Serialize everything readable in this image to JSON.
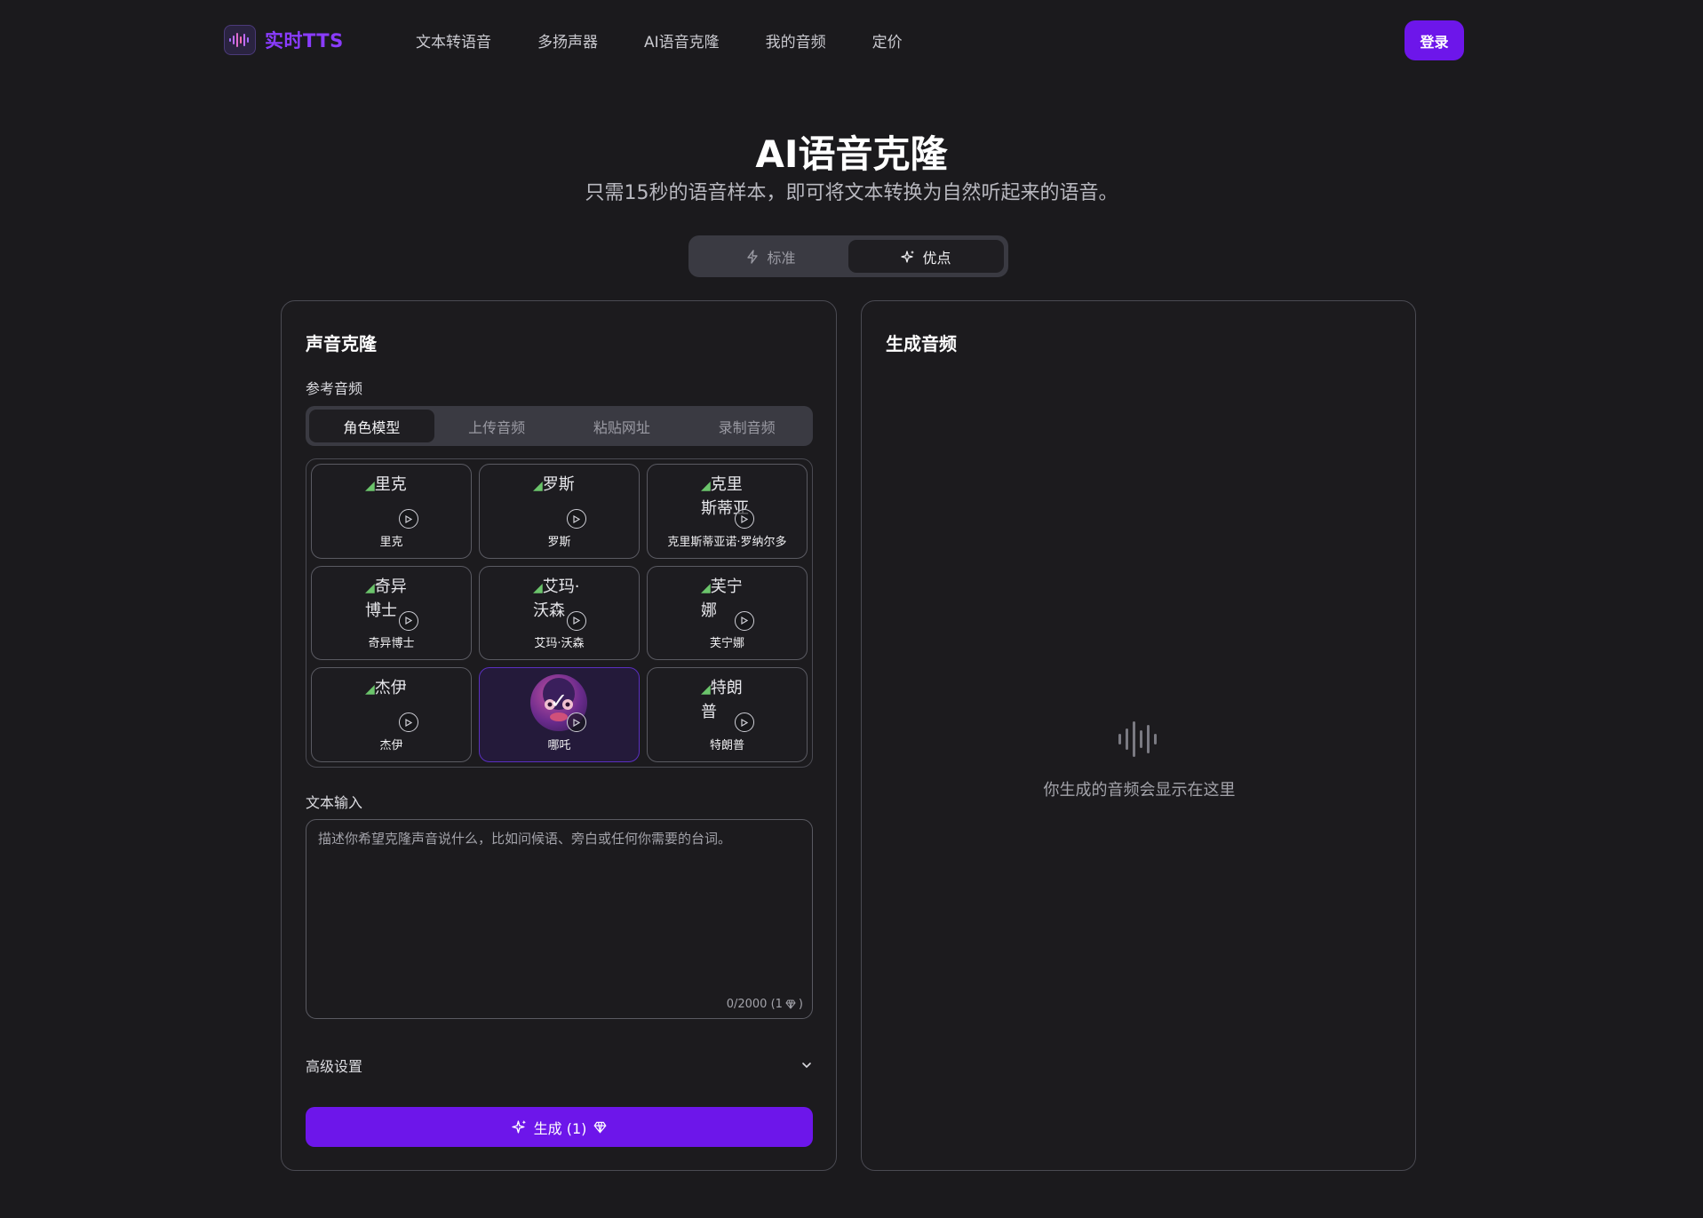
{
  "header": {
    "logo_text": "实时TTS",
    "nav": [
      "文本转语音",
      "多扬声器",
      "AI语音克隆",
      "我的音频",
      "定价"
    ],
    "login_label": "登录"
  },
  "hero": {
    "title": "AI语音克隆",
    "subtitle": "只需15秒的语音样本，即可将文本转换为自然听起来的语音。"
  },
  "mode_switch": {
    "options": [
      "标准",
      "优点"
    ],
    "active": "优点"
  },
  "left_panel": {
    "title": "声音克隆",
    "reference_label": "参考音频",
    "tabs": [
      "角色模型",
      "上传音频",
      "粘贴网址",
      "录制音频"
    ],
    "active_tab": "角色模型",
    "voices": [
      {
        "name": "里克",
        "img_alt": "里克",
        "selected": false
      },
      {
        "name": "罗斯",
        "img_alt": "罗斯",
        "selected": false
      },
      {
        "name": "克里斯蒂亚诺·罗纳尔多",
        "img_alt": "克里斯蒂亚",
        "selected": false
      },
      {
        "name": "奇异博士",
        "img_alt": "奇异博士",
        "selected": false
      },
      {
        "name": "艾玛·沃森",
        "img_alt": "艾玛·沃森",
        "selected": false
      },
      {
        "name": "芙宁娜",
        "img_alt": "芙宁娜",
        "selected": false
      },
      {
        "name": "杰伊",
        "img_alt": "杰伊",
        "selected": false
      },
      {
        "name": "哪吒",
        "img_alt": "",
        "selected": true
      },
      {
        "name": "特朗普",
        "img_alt": "特朗普",
        "selected": false
      }
    ],
    "text_input_label": "文本输入",
    "text_input_placeholder": "描述你希望克隆声音说什么，比如问候语、旁白或任何你需要的台词。",
    "text_input_value": "",
    "counter": "0/2000 (1",
    "advanced_label": "高级设置",
    "generate_label": "生成 (1)"
  },
  "right_panel": {
    "title": "生成音频",
    "empty_text": "你生成的音频会显示在这里"
  },
  "colors": {
    "accent": "#6d16ea",
    "logo": "#8a3cff",
    "background": "#1b1a1d"
  },
  "icons": {
    "logo": "waveform-icon",
    "standard": "lightning-icon",
    "pro": "sparkle-icon",
    "play": "play-icon",
    "gem": "gem-icon",
    "chevron": "chevron-down-icon",
    "empty": "waveform-icon"
  }
}
